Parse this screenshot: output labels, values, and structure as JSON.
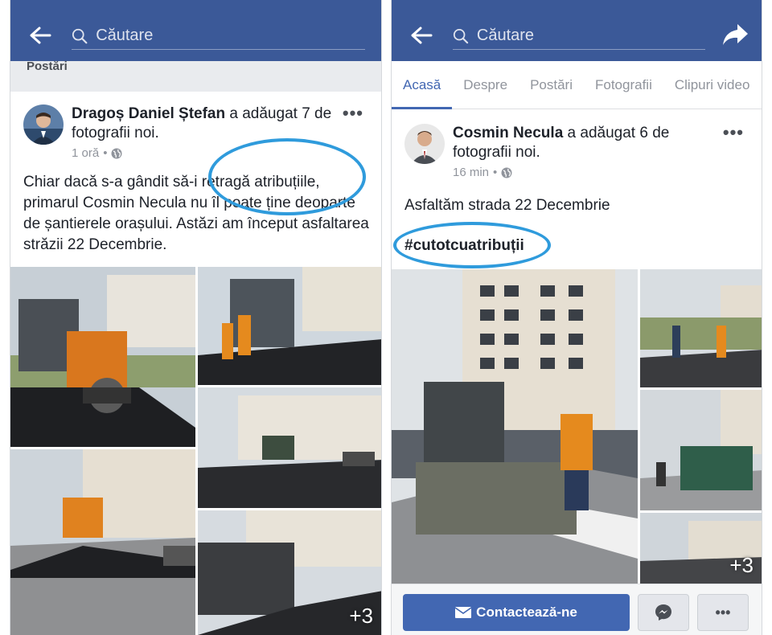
{
  "left": {
    "search": {
      "placeholder": "Căutare"
    },
    "section_title": "Postări",
    "post": {
      "author": "Dragoș Daniel Ștefan",
      "action": " a adăugat 7 de fotografii noi.",
      "time": "1 oră",
      "separator": "•",
      "text": "Chiar dacă s-a gândit să-i retragă atribuțiile, primarul Cosmin Necula nu îl poate ține deoparte de șantierele orașului. Astăzi am început asfaltarea străzii 22 Decembrie.",
      "more_photos": "+3",
      "more_icon": "•••"
    }
  },
  "right": {
    "search": {
      "placeholder": "Căutare"
    },
    "tabs": [
      "Acasă",
      "Despre",
      "Postări",
      "Fotografii",
      "Clipuri video"
    ],
    "post": {
      "author": "Cosmin Necula",
      "action": " a adăugat 6 de fotografii noi.",
      "time": "16 min",
      "separator": "•",
      "text": "Asfaltăm strada 22 Decembrie",
      "hashtag": "#cutotcuatribuții",
      "more_photos": "+3",
      "more_icon": "•••"
    },
    "actions": {
      "contact_label": "Contactează-ne",
      "more_label": "•••"
    }
  },
  "colors": {
    "brand": "#3b5998",
    "button": "#4267b2",
    "annotation": "#2f9bdc"
  }
}
